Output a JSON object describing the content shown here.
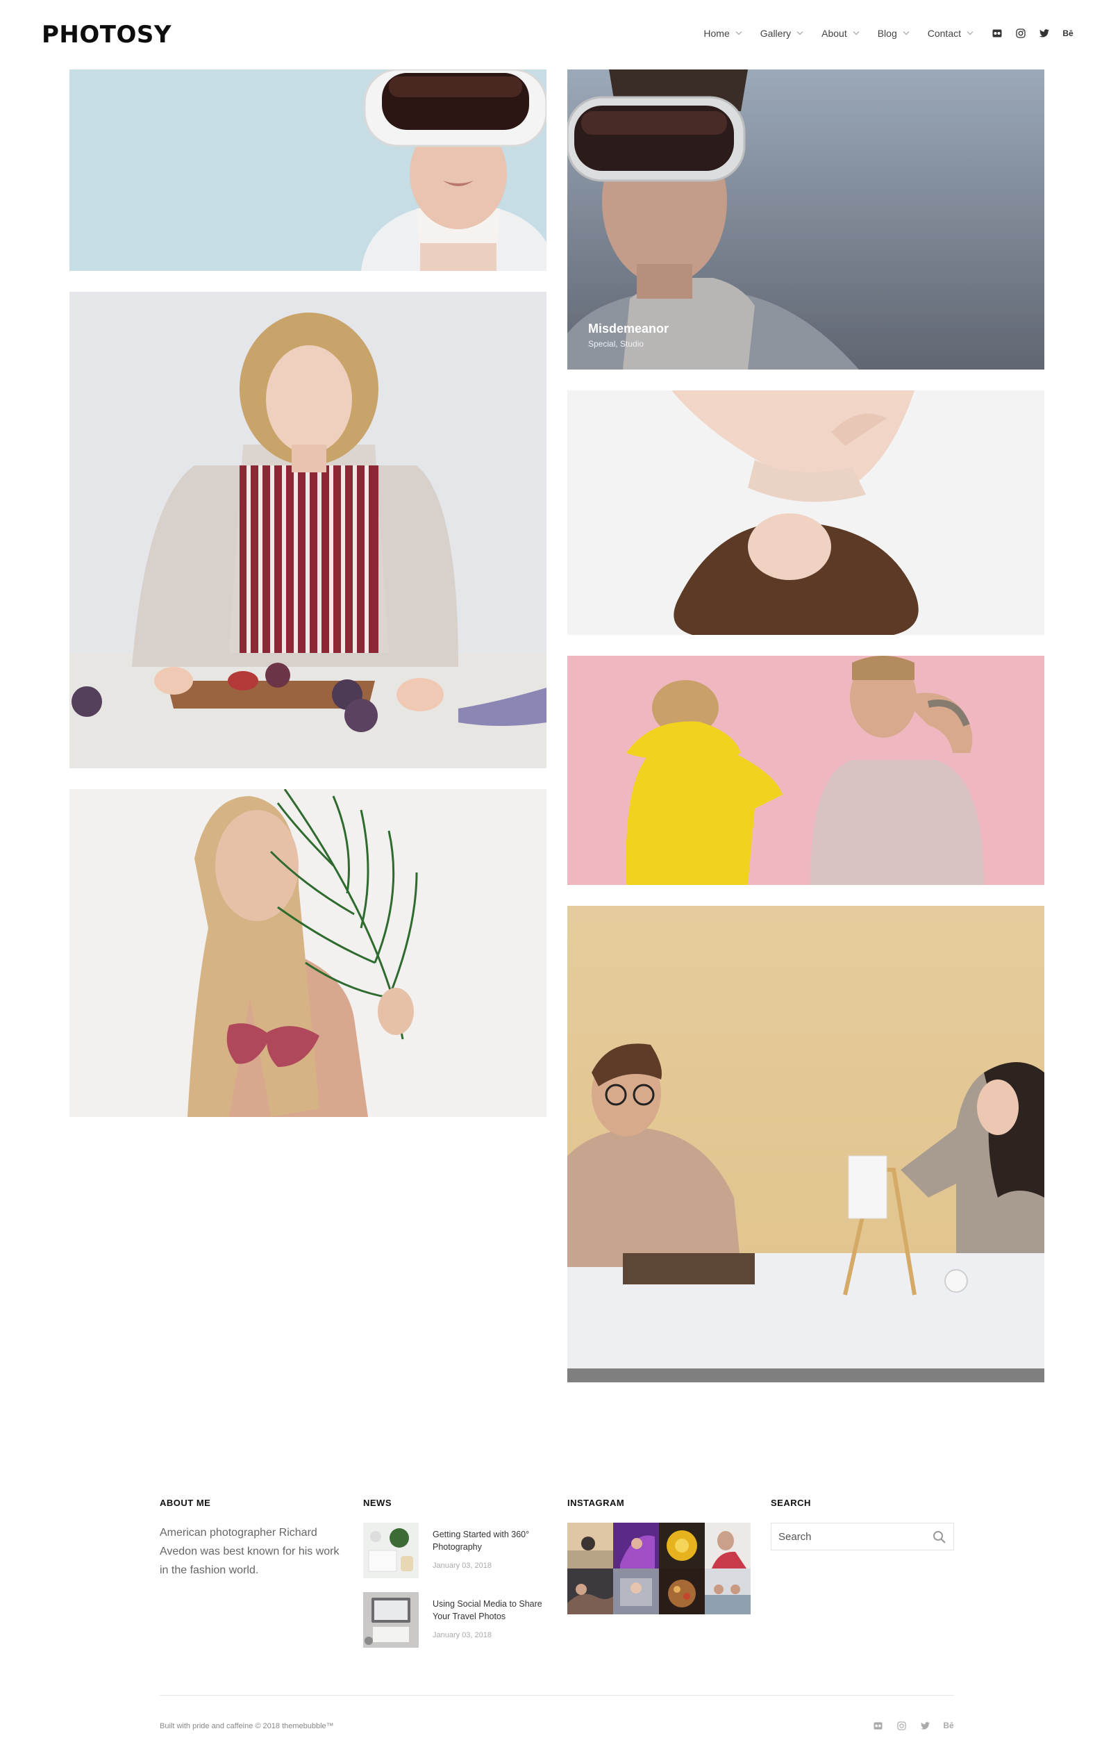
{
  "brand": {
    "logo": "PHOTOSY"
  },
  "nav": {
    "items": [
      {
        "label": "Home"
      },
      {
        "label": "Gallery"
      },
      {
        "label": "About"
      },
      {
        "label": "Blog"
      },
      {
        "label": "Contact"
      }
    ]
  },
  "social": {
    "icons": [
      "flickr-icon",
      "instagram-icon",
      "twitter-icon",
      "behance-icon"
    ],
    "behance_glyph": "Bē"
  },
  "gallery": {
    "featured": {
      "title": "Misdemeanor",
      "categories": "Special, Studio"
    }
  },
  "footer": {
    "about": {
      "title": "ABOUT ME",
      "text": "American photographer Richard Avedon was best known for his work in the fashion world."
    },
    "news": {
      "title": "NEWS",
      "items": [
        {
          "title": "Getting Started with 360° Photography",
          "date": "January 03, 2018"
        },
        {
          "title": "Using Social Media to Share Your Travel Photos",
          "date": "January 03, 2018"
        }
      ]
    },
    "instagram": {
      "title": "INSTAGRAM"
    },
    "search": {
      "title": "SEARCH",
      "placeholder": "Search"
    },
    "copyright": "Built with pride and caffeine © 2018 themebubble™"
  },
  "colors": {
    "accent": "#111111",
    "tile_blue": "#c6dde6",
    "tile_pink": "#efb8c0",
    "tile_sand": "#e3c996"
  }
}
